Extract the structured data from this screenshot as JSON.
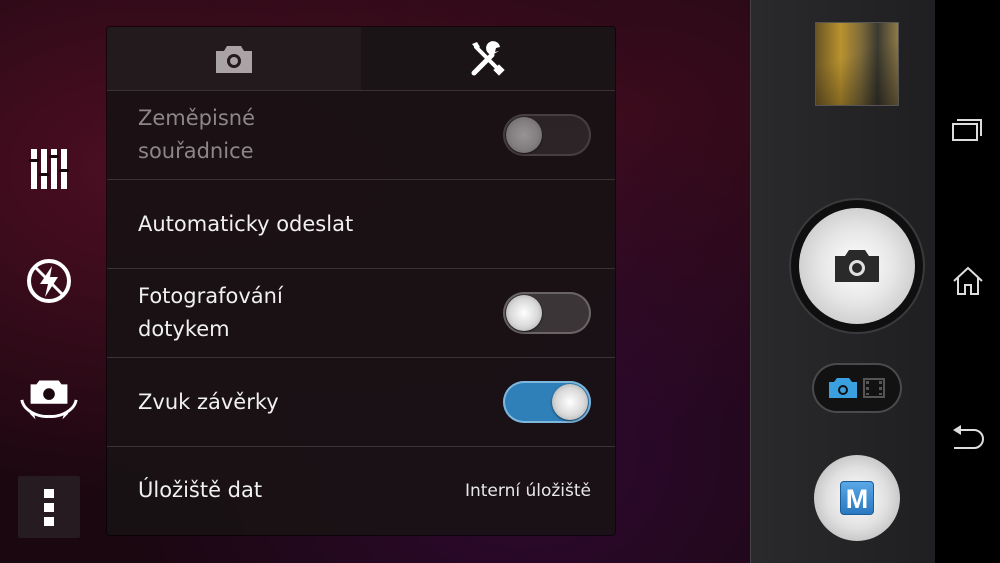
{
  "tabs": [
    {
      "name": "camera-settings",
      "icon": "camera-icon"
    },
    {
      "name": "general-settings",
      "icon": "tools-icon",
      "active": true
    }
  ],
  "settings": {
    "geotag": {
      "label_line1": "Zeměpisné",
      "label_line2": "souřadnice",
      "state": "off",
      "enabled": false
    },
    "auto_upload": {
      "label": "Automaticky odeslat"
    },
    "touch_capture": {
      "label_line1": "Fotografování",
      "label_line2": "dotykem",
      "state": "off"
    },
    "shutter_sound": {
      "label": "Zvuk závěrky",
      "state": "on"
    },
    "storage": {
      "label": "Úložiště dat",
      "value": "Interní úložiště"
    }
  },
  "left_controls": [
    "settings-sliders-icon",
    "flash-off-icon",
    "switch-camera-icon",
    "menu-icon"
  ],
  "right_controls": {
    "mode_button_label": "M",
    "capture_mode": "photo"
  },
  "navbar": [
    "recent-apps-icon",
    "home-icon",
    "back-icon"
  ],
  "colors": {
    "toggle_on": "#2f7fb8",
    "accent_blue": "#3aa0e0"
  }
}
